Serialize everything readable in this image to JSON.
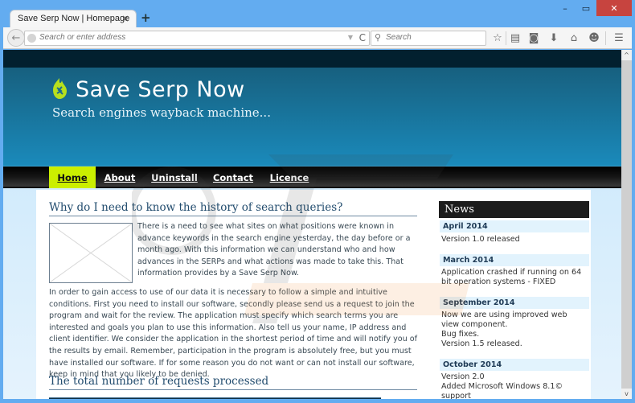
{
  "browser": {
    "tab_title": "Save Serp Now | Homepage",
    "tab_close_icon": "×",
    "new_tab_icon": "+",
    "window_controls": {
      "minimize": "–",
      "maximize": "▭",
      "close": "✕"
    },
    "back_icon": "←",
    "url_placeholder": "Search or enter address",
    "url_value": "",
    "url_dropdown_icon": "▼",
    "reload_icon": "C",
    "search_placeholder": "Search",
    "search_icon": "⚲",
    "toolbar_icons": {
      "bookmark": "☆",
      "reading_list": "▤",
      "pocket": "◙",
      "downloads": "⬇",
      "home": "⌂",
      "chat": "☻",
      "menu": "☰"
    },
    "scroll_up_icon": "^",
    "scroll_down_icon": "v"
  },
  "site": {
    "title": "Save Serp Now",
    "tagline": "Search engines wayback machine...",
    "accent_color": "#cbef00",
    "nav": [
      {
        "label": "Home",
        "active": true
      },
      {
        "label": "About",
        "active": false
      },
      {
        "label": "Uninstall",
        "active": false
      },
      {
        "label": "Contact",
        "active": false
      },
      {
        "label": "Licence",
        "active": false
      }
    ]
  },
  "main": {
    "heading1": "Why do I need to know the history of search queries?",
    "intro": "There is a need to see what sites on what positions were known in advance keywords in the search engine yesterday, the day before or a month ago. With this information we can understand who and how advances in the SERPs and what actions was made to take this. That information provides by a Save Serp Now.",
    "body": "In order to gain access to use of our data it is necessary to follow a simple and intuitive conditions. First you need to install our software, secondly please send us a request to join the program and wait for the review. The application must specify which search terms you are interested and goals you plan to use this information. Also tell us your name, IP address and client identifier. We consider the application in the shortest period of time and will notify you of the results by email. Remember, participation in the program is absolutely free, but you must have installed our software. If for some reason you do not want or can not install our software, keep in mind that you likely to be denied.",
    "heading2": "The total number of requests processed"
  },
  "news": {
    "title": "News",
    "items": [
      {
        "date": "April 2014",
        "lines": [
          "Version 1.0 released"
        ]
      },
      {
        "date": "March 2014",
        "lines": [
          "Application crashed if running on 64 bit operation systems - FIXED"
        ]
      },
      {
        "date": "September 2014",
        "lines": [
          "Now we are using improved web view component.",
          "Bug fixes.",
          "Version 1.5 released."
        ]
      },
      {
        "date": "October 2014",
        "lines": [
          "Version 2.0",
          "Added Microsoft Windows 8.1© support"
        ]
      }
    ]
  }
}
